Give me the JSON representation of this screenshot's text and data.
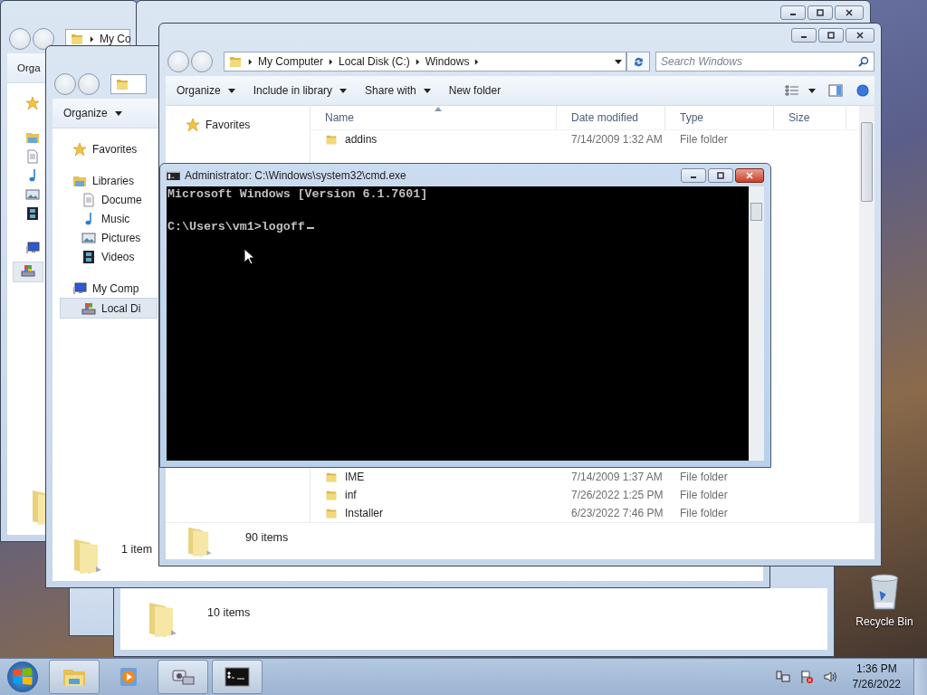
{
  "window_a": {
    "address": "My Co",
    "toolbar": "Orga"
  },
  "window_c": {
    "toolbar": "Organize",
    "status": "1 item",
    "nav": [
      {
        "label": "Favorites",
        "kind": "favorites",
        "selected": false
      },
      {
        "label": "Libraries",
        "kind": "library",
        "selected": false,
        "children": [
          {
            "label": "Docume",
            "kind": "documents",
            "selected": false
          },
          {
            "label": "Music",
            "kind": "music",
            "selected": false
          },
          {
            "label": "Pictures",
            "kind": "pictures",
            "selected": false
          },
          {
            "label": "Videos",
            "kind": "videos",
            "selected": false
          }
        ]
      },
      {
        "label": "My Comp",
        "kind": "computer",
        "selected": false,
        "children": [
          {
            "label": "Local Di",
            "kind": "disk",
            "selected": true
          }
        ]
      }
    ]
  },
  "window_d": {
    "status": "10 items"
  },
  "explorer": {
    "breadcrumbs": [
      "My Computer",
      "Local Disk (C:)",
      "Windows"
    ],
    "search": {
      "placeholder": "Search Windows"
    },
    "toolbar": [
      {
        "label": "Organize",
        "dropdown": true
      },
      {
        "label": "Include in library",
        "dropdown": true
      },
      {
        "label": "Share with",
        "dropdown": true
      },
      {
        "label": "New folder",
        "dropdown": false
      }
    ],
    "nav": [
      {
        "label": "Favorites",
        "kind": "favorites",
        "selected": false
      }
    ],
    "columns": [
      "Name",
      "Date modified",
      "Type",
      "Size"
    ],
    "rows": [
      {
        "name": "addins",
        "date": "7/14/2009 1:32 AM",
        "type": "File folder"
      },
      {
        "name": "IME",
        "date": "7/14/2009 1:37 AM",
        "type": "File folder"
      },
      {
        "name": "inf",
        "date": "7/26/2022 1:25 PM",
        "type": "File folder"
      },
      {
        "name": "Installer",
        "date": "6/23/2022 7:46 PM",
        "type": "File folder"
      }
    ],
    "status": "90 items"
  },
  "cmd": {
    "title": "Administrator: C:\\Windows\\system32\\cmd.exe",
    "lines": [
      "Microsoft Windows [Version 6.1.7601]",
      "C:\\Users\\vm1>logoff"
    ]
  },
  "desktop_icons": [
    {
      "label": "Recycle Bin"
    }
  ],
  "taskbar": {
    "buttons": [
      {
        "kind": "explorer",
        "running": true
      },
      {
        "kind": "media",
        "running": false
      },
      {
        "kind": "devices",
        "running": true
      },
      {
        "kind": "cmd",
        "running": true
      }
    ],
    "time": "1:36 PM",
    "date": "7/26/2022"
  }
}
